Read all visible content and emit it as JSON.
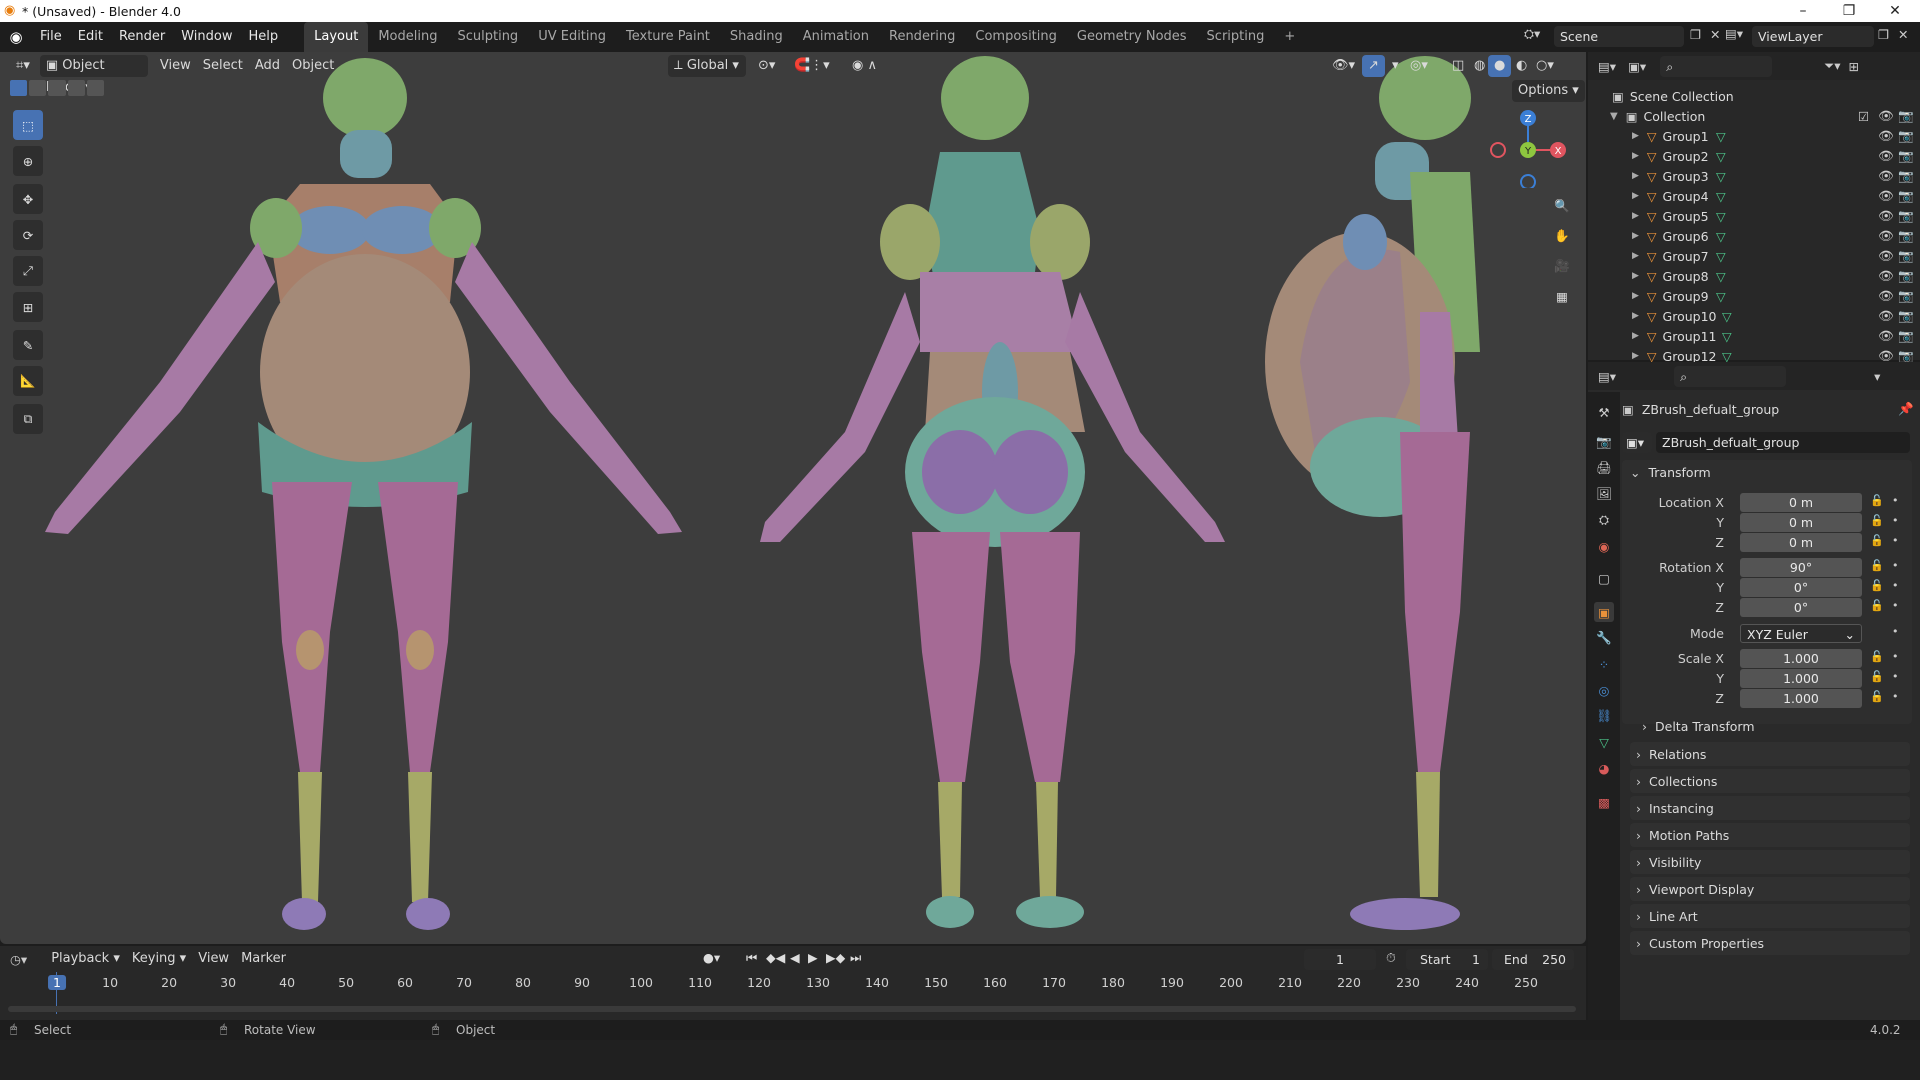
{
  "window": {
    "title": "* (Unsaved) - Blender 4.0",
    "minimize": "–",
    "maximize": "❐",
    "close": "✕"
  },
  "menu": [
    "File",
    "Edit",
    "Render",
    "Window",
    "Help"
  ],
  "workspaces": [
    "Layout",
    "Modeling",
    "Sculpting",
    "UV Editing",
    "Texture Paint",
    "Shading",
    "Animation",
    "Rendering",
    "Compositing",
    "Geometry Nodes",
    "Scripting"
  ],
  "workspace_add": "+",
  "scene": {
    "name": "Scene",
    "view_layer": "ViewLayer"
  },
  "viewport": {
    "mode": "Object Mode",
    "menus": [
      "View",
      "Select",
      "Add",
      "Object"
    ],
    "orientation": "Global",
    "options": "Options"
  },
  "gizmo": {
    "z": "Z",
    "y": "Y",
    "x": "X"
  },
  "outliner": {
    "scene_collection": "Scene Collection",
    "collection": "Collection",
    "items": [
      "Group1",
      "Group2",
      "Group3",
      "Group4",
      "Group5",
      "Group6",
      "Group7",
      "Group8",
      "Group9",
      "Group10",
      "Group11",
      "Group12"
    ]
  },
  "properties": {
    "object_name": "ZBrush_defualt_group",
    "data_name": "ZBrush_defualt_group",
    "transform_title": "Transform",
    "location": {
      "label": "Location X",
      "x": "0 m",
      "y": "0 m",
      "z": "0 m"
    },
    "rotation": {
      "label": "Rotation X",
      "x": "90°",
      "y": "0°",
      "z": "0°"
    },
    "axis_y": "Y",
    "axis_z": "Z",
    "mode_label": "Mode",
    "mode": "XYZ Euler",
    "scale": {
      "label": "Scale X",
      "x": "1.000",
      "y": "1.000",
      "z": "1.000"
    },
    "delta": "Delta Transform",
    "panels": [
      "Relations",
      "Collections",
      "Instancing",
      "Motion Paths",
      "Visibility",
      "Viewport Display",
      "Line Art",
      "Custom Properties"
    ]
  },
  "timeline": {
    "menus": [
      "Playback",
      "Keying",
      "View",
      "Marker"
    ],
    "current_frame": "1",
    "start_label": "Start",
    "start": "1",
    "end_label": "End",
    "end": "250",
    "ticks": [
      "1",
      "10",
      "20",
      "30",
      "40",
      "50",
      "60",
      "70",
      "80",
      "90",
      "100",
      "110",
      "120",
      "130",
      "140",
      "150",
      "160",
      "170",
      "180",
      "190",
      "200",
      "210",
      "220",
      "230",
      "240",
      "250"
    ]
  },
  "status": {
    "select": "Select",
    "rotate": "Rotate View",
    "object": "Object",
    "version": "4.0.2"
  },
  "colors": {
    "accent": "#4772b3",
    "viewport_bg": "#3d3d3d",
    "panel_bg": "#2a2a2a"
  }
}
